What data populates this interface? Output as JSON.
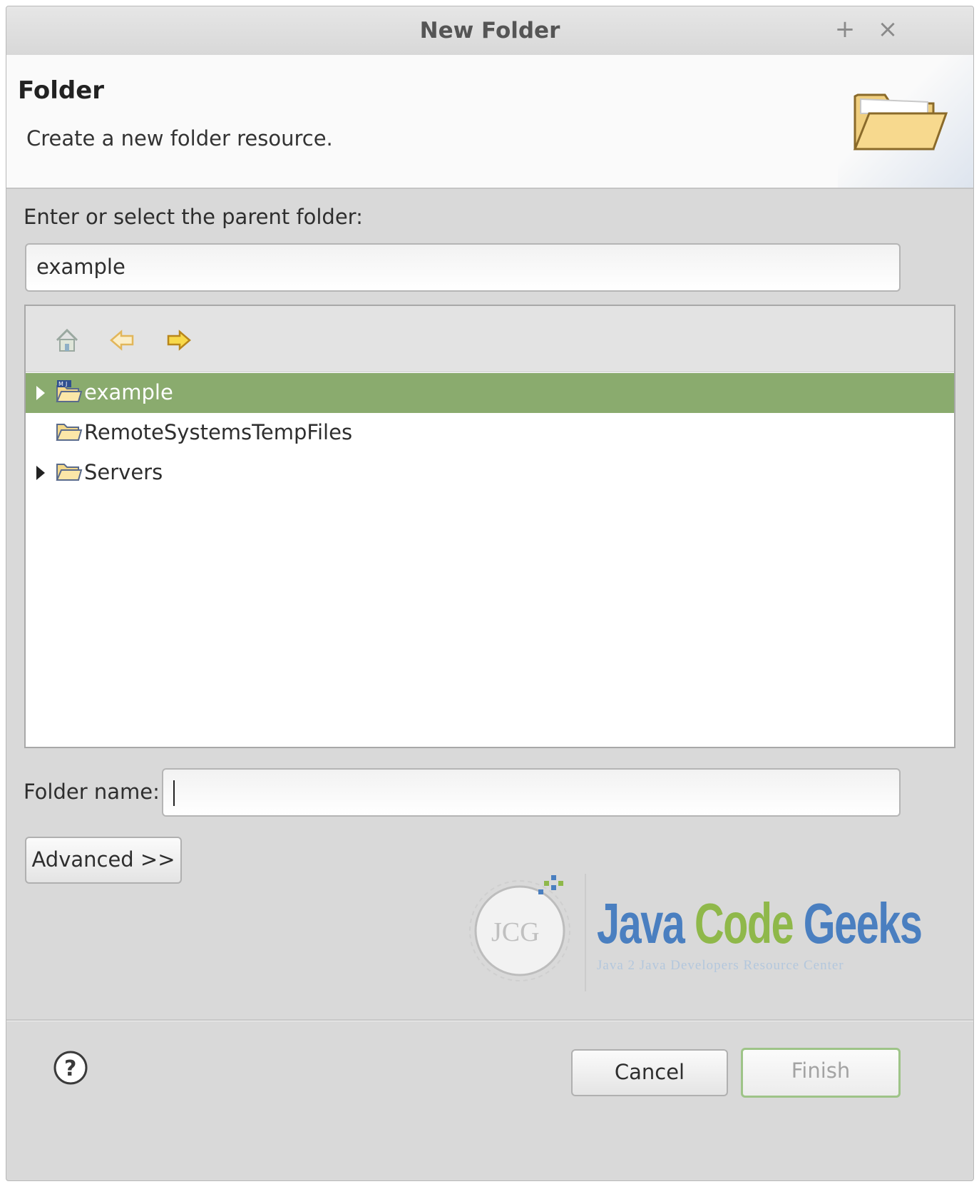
{
  "window": {
    "title": "New Folder",
    "maximize_glyph": "+",
    "close_glyph": "×"
  },
  "banner": {
    "title": "Folder",
    "description": "Create a new folder resource.",
    "icon": "open-folder-icon"
  },
  "parent_folder": {
    "label": "Enter or select the parent folder:",
    "value": "example"
  },
  "tree_toolbar": {
    "icons": [
      "home-icon",
      "back-arrow-icon",
      "forward-arrow-icon"
    ]
  },
  "tree": {
    "items": [
      {
        "label": "example",
        "icon": "maven-project-folder-icon",
        "expandable": true,
        "selected": true
      },
      {
        "label": "RemoteSystemsTempFiles",
        "icon": "folder-icon",
        "expandable": false,
        "selected": false
      },
      {
        "label": "Servers",
        "icon": "folder-icon",
        "expandable": true,
        "selected": false
      }
    ]
  },
  "folder_name": {
    "label": "Folder name:",
    "value": ""
  },
  "buttons": {
    "advanced": "Advanced >>",
    "cancel": "Cancel",
    "finish": "Finish",
    "help_glyph": "?"
  },
  "watermark": {
    "badge_text": "JCG",
    "word1": "Java",
    "word2": "Code",
    "word3": "Geeks",
    "tagline": "Java 2 Java Developers Resource Center"
  },
  "colors": {
    "selection": "#8aab6e",
    "finish_border": "#9ec488",
    "watermark_blue": "#4a7fc0",
    "watermark_green": "#8fb84a"
  }
}
